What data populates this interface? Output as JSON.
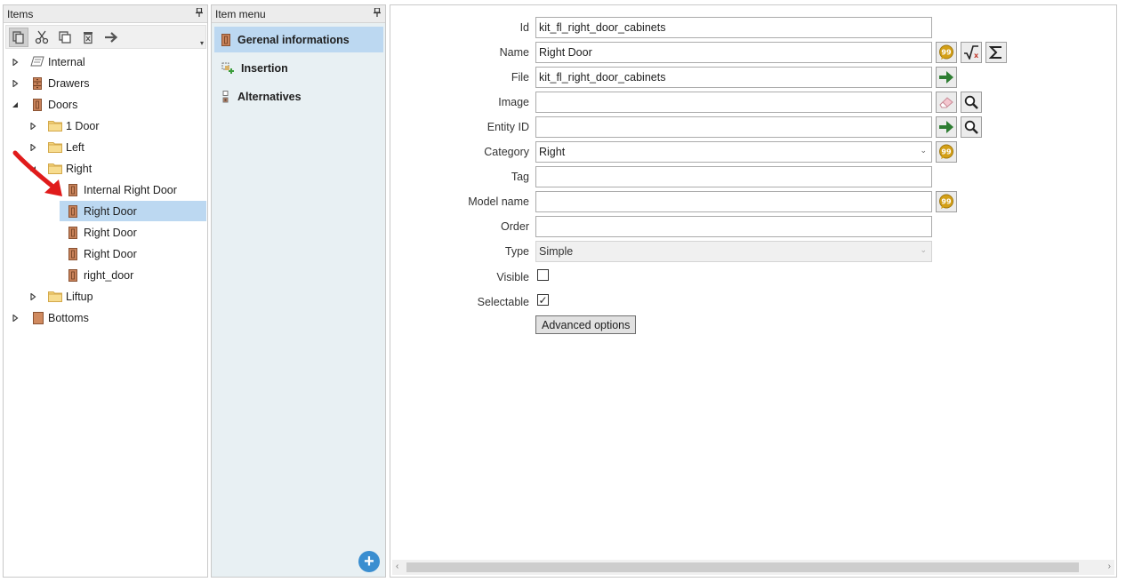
{
  "items_panel": {
    "title": "Items",
    "toolbar": [
      "copy-icon",
      "cut-icon",
      "duplicate-icon",
      "delete-icon",
      "move-icon"
    ],
    "tree": [
      {
        "label": "Internal",
        "level": 0,
        "expander": "collapsed",
        "icon": "panel-icon"
      },
      {
        "label": "Drawers",
        "level": 0,
        "expander": "collapsed",
        "icon": "drawer-icon"
      },
      {
        "label": "Doors",
        "level": 0,
        "expander": "expanded",
        "icon": "door-icon"
      },
      {
        "label": "1 Door",
        "level": 1,
        "expander": "collapsed",
        "icon": "folder-icon"
      },
      {
        "label": "Left",
        "level": 1,
        "expander": "collapsed",
        "icon": "folder-icon"
      },
      {
        "label": "Right",
        "level": 1,
        "expander": "expanded",
        "icon": "folder-icon"
      },
      {
        "label": "Internal Right Door",
        "level": 2,
        "expander": "none",
        "icon": "door-icon"
      },
      {
        "label": "Right Door",
        "level": 2,
        "expander": "none",
        "icon": "door-icon",
        "selected": true
      },
      {
        "label": "Right Door",
        "level": 2,
        "expander": "none",
        "icon": "door-icon"
      },
      {
        "label": "Right Door",
        "level": 2,
        "expander": "none",
        "icon": "door-icon"
      },
      {
        "label": "right_door",
        "level": 2,
        "expander": "none",
        "icon": "door-icon"
      },
      {
        "label": "Liftup",
        "level": 1,
        "expander": "collapsed",
        "icon": "folder-icon"
      },
      {
        "label": "Bottoms",
        "level": 0,
        "expander": "collapsed",
        "icon": "bottom-icon"
      }
    ]
  },
  "menu_panel": {
    "title": "Item menu",
    "items": [
      {
        "label": "Gerenal informations",
        "icon": "door-icon",
        "selected": true
      },
      {
        "label": "Insertion",
        "icon": "insertion-icon"
      },
      {
        "label": "Alternatives",
        "icon": "alternatives-icon"
      }
    ],
    "add_icon": "add-circle-icon"
  },
  "properties": {
    "id": {
      "label": "Id",
      "value": "kit_fl_right_door_cabinets"
    },
    "name": {
      "label": "Name",
      "value": "Right Door"
    },
    "file": {
      "label": "File",
      "value": "kit_fl_right_door_cabinets"
    },
    "image": {
      "label": "Image",
      "value": ""
    },
    "entity_id": {
      "label": "Entity ID",
      "value": ""
    },
    "category": {
      "label": "Category",
      "value": "Right"
    },
    "tag": {
      "label": "Tag",
      "value": ""
    },
    "model_name": {
      "label": "Model name",
      "value": ""
    },
    "order": {
      "label": "Order",
      "value": ""
    },
    "type": {
      "label": "Type",
      "value": "Simple"
    },
    "visible": {
      "label": "Visible",
      "checked": false
    },
    "selectable": {
      "label": "Selectable",
      "checked": true,
      "mark": "✓"
    },
    "advanced_button": "Advanced options"
  },
  "colors": {
    "selection": "#bcd8f1",
    "menu_bg": "#e8f0f3",
    "door_icon": "#c8825a",
    "folder": "#f3d27a",
    "arrow_green": "#2e7d32",
    "translate_gold": "#d4a017",
    "annotation_red": "#e01b1b"
  }
}
